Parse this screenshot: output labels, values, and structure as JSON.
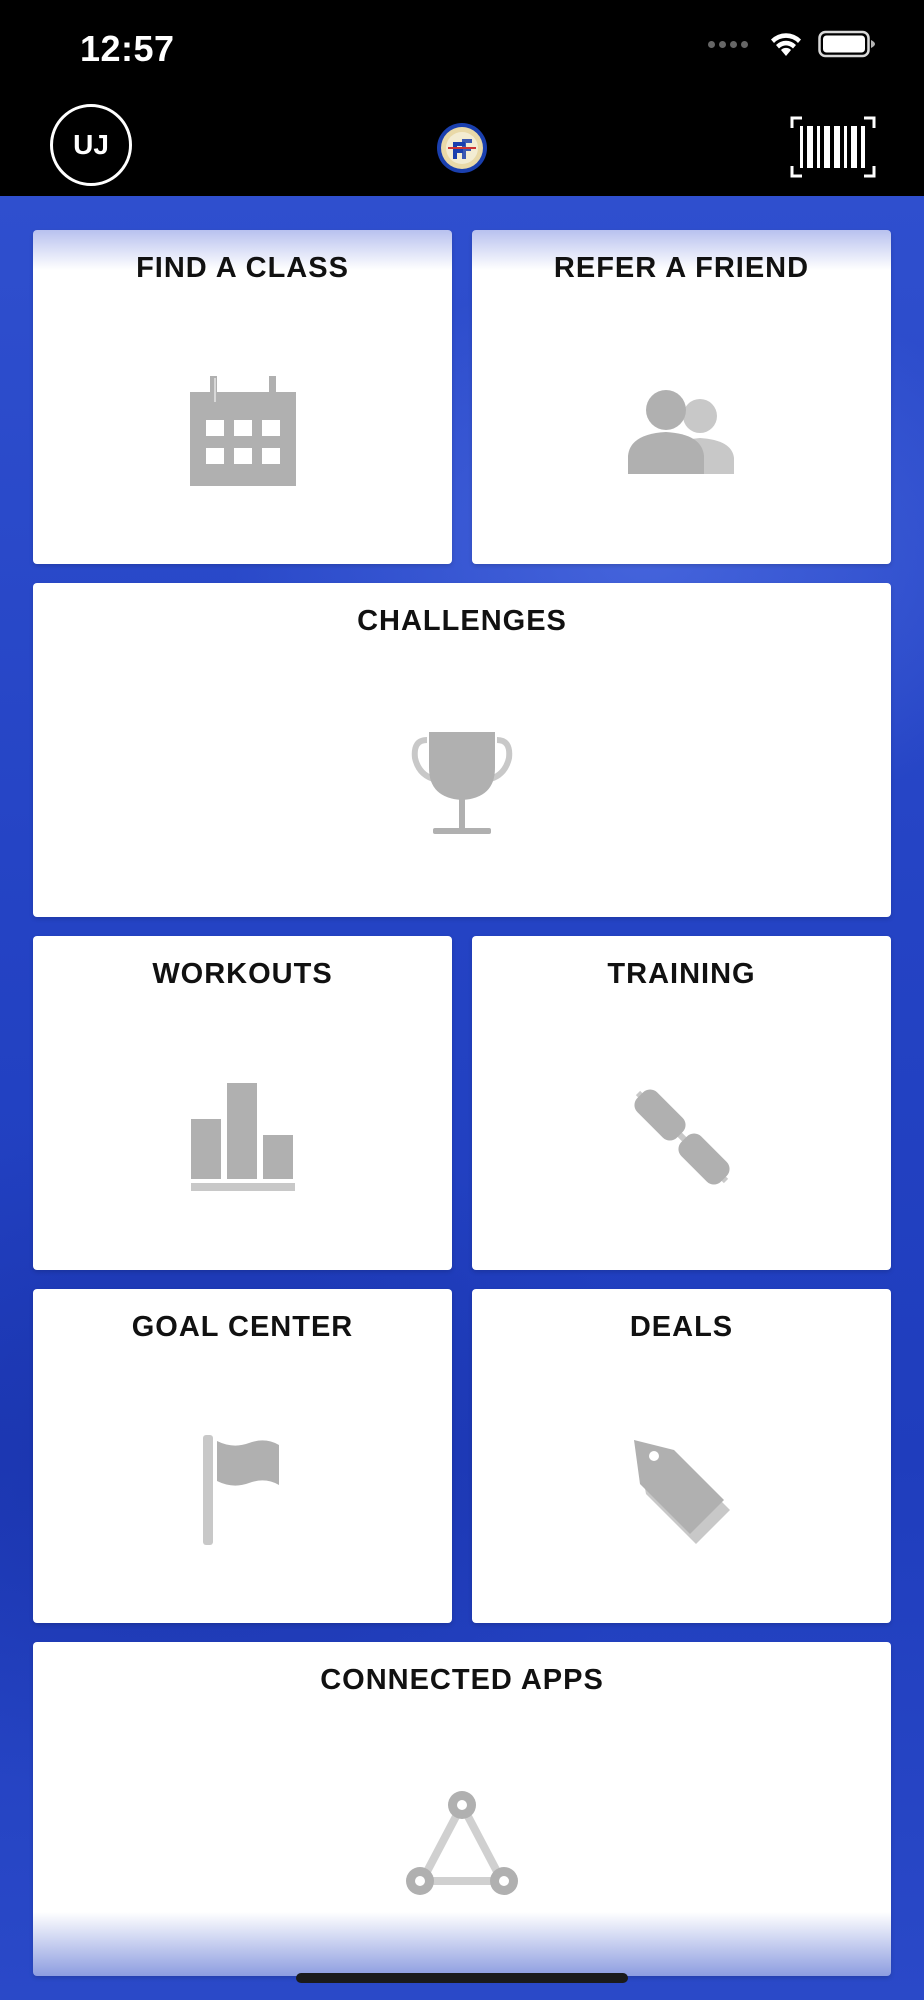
{
  "status_bar": {
    "time": "12:57"
  },
  "header": {
    "avatar_initials": "UJ"
  },
  "tiles": {
    "find_class": "FIND A CLASS",
    "refer_friend": "REFER A FRIEND",
    "challenges": "CHALLENGES",
    "workouts": "WORKOUTS",
    "training": "TRAINING",
    "goal_center": "GOAL CENTER",
    "deals": "DEALS",
    "connected_apps": "CONNECTED APPS"
  },
  "icons": {
    "find_class": "calendar-icon",
    "refer_friend": "people-icon",
    "challenges": "trophy-icon",
    "workouts": "bar-chart-icon",
    "training": "dumbbell-icon",
    "goal_center": "flag-icon",
    "deals": "price-tag-icon",
    "connected_apps": "network-icon"
  },
  "colors": {
    "header_bg": "#000000",
    "background_blue": "#2443c4",
    "tile_bg": "#ffffff",
    "icon_gray": "#b0b0b0",
    "title_text": "#111111"
  }
}
